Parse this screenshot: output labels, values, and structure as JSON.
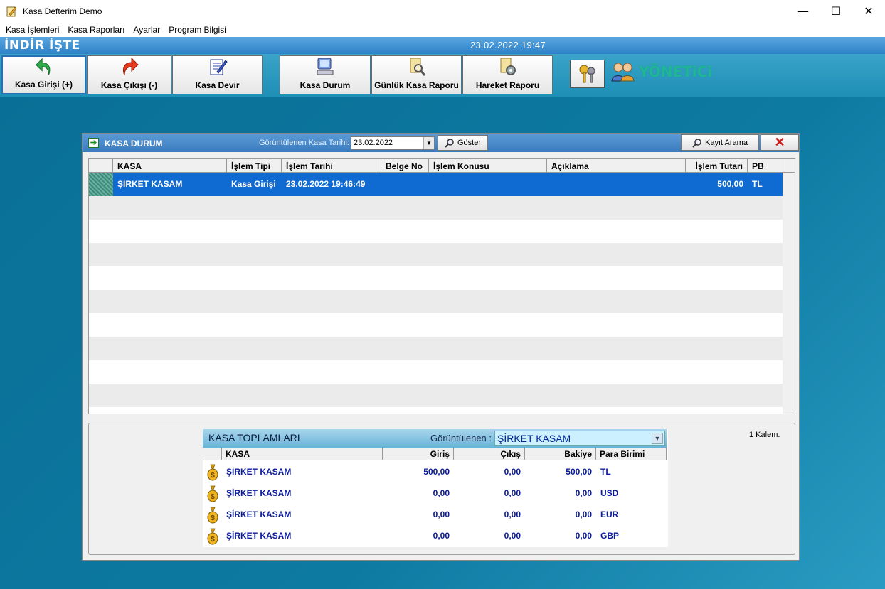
{
  "window": {
    "title": "Kasa Defterim Demo",
    "minimize": "—",
    "maximize": "☐",
    "close": "✕"
  },
  "menu": [
    "Kasa İşlemleri",
    "Kasa Raporları",
    "Ayarlar",
    "Program Bilgisi"
  ],
  "header": {
    "brand": "İNDİR İŞTE",
    "datetime": "23.02.2022 19:47"
  },
  "toolbar": {
    "kasa_girisi": "Kasa Girişi  (+)",
    "kasa_cikisi": "Kasa Çıkışı (-)",
    "kasa_devir": "Kasa Devir",
    "kasa_durum": "Kasa Durum",
    "gunluk_rapor": "Günlük Kasa Raporu",
    "hareket_rapor": "Hareket Raporu",
    "user_role": "YÖNETiCi"
  },
  "panel": {
    "title": "KASA DURUM",
    "date_label": "Görüntülenen Kasa Tarihi:",
    "date_value": "23.02.2022",
    "show_button": "Göster",
    "search_button": "Kayıt Arama",
    "close_button": "✕"
  },
  "grid": {
    "columns": [
      "KASA",
      "İşlem Tipi",
      "İşlem Tarihi",
      "Belge No",
      "İşlem Konusu",
      "Açıklama",
      "İşlem Tutarı",
      "PB"
    ],
    "rows": [
      {
        "kasa": "ŞİRKET KASAM",
        "tip": "Kasa Girişi",
        "tarih": "23.02.2022 19:46:49",
        "belge": "",
        "konu": "",
        "aciklama": "",
        "tutar": "500,00",
        "pb": "TL"
      }
    ]
  },
  "totals": {
    "title": "KASA TOPLAMLARI",
    "view_label": "Görüntülenen :",
    "view_value": "ŞİRKET KASAM",
    "count_label": "1 Kalem.",
    "columns": [
      "KASA",
      "Giriş",
      "Çıkış",
      "Bakiye",
      "Para Birimi"
    ],
    "rows": [
      {
        "kasa": "ŞİRKET KASAM",
        "giris": "500,00",
        "cikis": "0,00",
        "bakiye": "500,00",
        "pb": "TL"
      },
      {
        "kasa": "ŞİRKET KASAM",
        "giris": "0,00",
        "cikis": "0,00",
        "bakiye": "0,00",
        "pb": "USD"
      },
      {
        "kasa": "ŞİRKET KASAM",
        "giris": "0,00",
        "cikis": "0,00",
        "bakiye": "0,00",
        "pb": "EUR"
      },
      {
        "kasa": "ŞİRKET KASAM",
        "giris": "0,00",
        "cikis": "0,00",
        "bakiye": "0,00",
        "pb": "GBP"
      }
    ]
  }
}
